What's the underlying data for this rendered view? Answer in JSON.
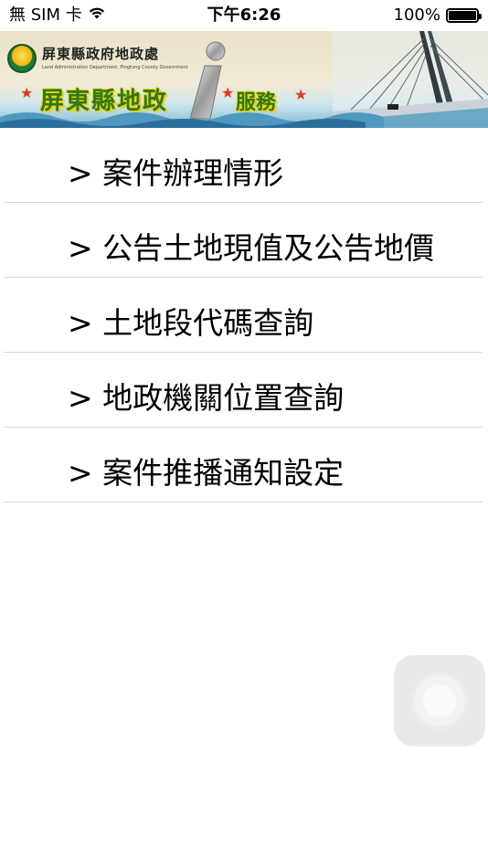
{
  "status_bar": {
    "carrier": "無 SIM 卡",
    "time": "下午6:26",
    "battery": "100%"
  },
  "banner": {
    "org_name": "屏東縣政府地政處",
    "org_name_en": "Land Administration Department, Pingtung County Government",
    "title": "屏東縣地政",
    "service": "服務"
  },
  "menu": {
    "items": [
      {
        "label": "> 案件辦理情形"
      },
      {
        "label": "> 公告土地現值及公告地價"
      },
      {
        "label": "> 土地段代碼查詢"
      },
      {
        "label": "> 地政機關位置查詢"
      },
      {
        "label": "> 案件推播通知設定"
      }
    ]
  },
  "colors": {
    "banner_title": "#2a7a1a",
    "banner_outline": "#f5d000",
    "divider": "#d9d9d9"
  },
  "icons": [
    "wifi-icon",
    "battery-icon",
    "county-logo-icon",
    "assistive-touch-icon"
  ]
}
